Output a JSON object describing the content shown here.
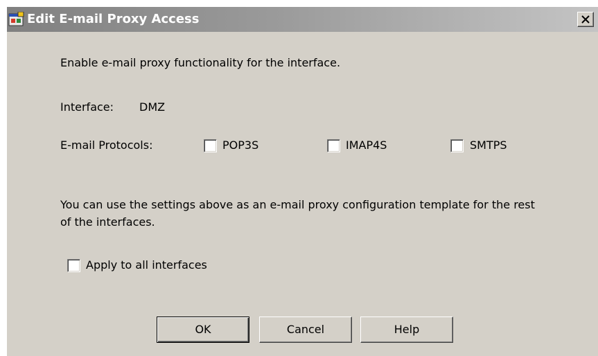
{
  "window": {
    "title": "Edit E-mail Proxy Access"
  },
  "content": {
    "description": "Enable e-mail proxy functionality for the interface.",
    "interface_label": "Interface:",
    "interface_value": "DMZ",
    "protocols_label": "E-mail Protocols:",
    "protocols": [
      {
        "label": "POP3S",
        "checked": false
      },
      {
        "label": "IMAP4S",
        "checked": false
      },
      {
        "label": "SMTPS",
        "checked": false
      }
    ],
    "template_note": "You can use the settings above as an e-mail proxy configuration template for the rest of the interfaces.",
    "apply_all": {
      "label": "Apply to all interfaces",
      "checked": false
    }
  },
  "buttons": {
    "ok": "OK",
    "cancel": "Cancel",
    "help": "Help"
  },
  "icons": {
    "app": "app-window-icon",
    "close": "close-icon"
  }
}
